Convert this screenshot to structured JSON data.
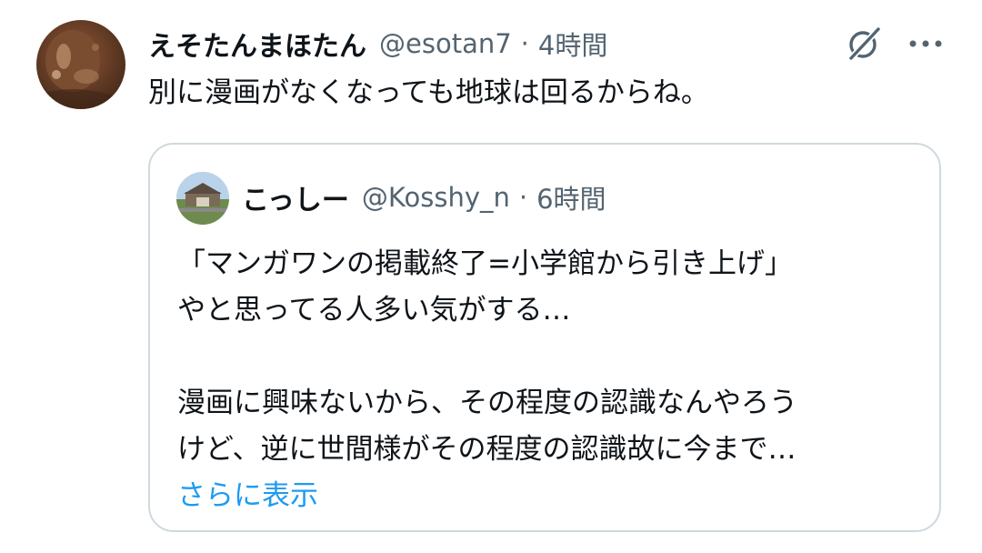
{
  "tweet": {
    "display_name": "えそたんまほたん",
    "handle": "@esotan7",
    "separator": "·",
    "time": "4時間",
    "text": "別に漫画がなくなっても地球は回るからね。"
  },
  "quoted_tweet": {
    "display_name": "こっしー",
    "handle": "@Kosshy_n",
    "separator": "·",
    "time": "6時間",
    "lines": [
      "「マンガワンの掲載終了=小学館から引き上げ」",
      "やと思ってる人多い気がする…",
      "",
      "漫画に興味ないから、その程度の認識なんやろう",
      "けど、逆に世間様がその程度の認識故に今まで…"
    ],
    "show_more": "さらに表示"
  },
  "icons": {
    "grok": "grok-icon",
    "more": "more-icon"
  },
  "colors": {
    "text": "#0f1419",
    "secondary": "#536471",
    "link": "#1d9bf0",
    "border": "#cfd9de"
  }
}
